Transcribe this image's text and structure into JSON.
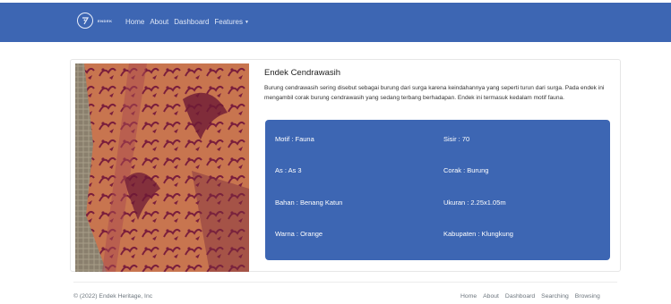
{
  "navbar": {
    "brand_text": "ENDEK",
    "links": [
      "Home",
      "About",
      "Dashboard"
    ],
    "dropdown_label": "Features",
    "bg_color": "#3d66b3"
  },
  "card": {
    "image_alt": "Endek Cendrawasih fabric",
    "title": "Endek Cendrawasih",
    "description": "Burung cendrawasih sering disebut sebagai burung dari surga karena keindahannya yang seperti turun dari surga. Pada endek ini mengambil corak burung cendrawasih yang sedang terbang berhadapan. Endek ini termasuk kedalam motif fauna.",
    "details": {
      "motif": "Motif : Fauna",
      "sisir": "Sisir : 70",
      "as": "As : As 3",
      "corak": "Corak : Burung",
      "bahan": "Bahan : Benang Katun",
      "ukuran": "Ukuran : 2.25x1.05m",
      "warna": "Warna : Orange",
      "kabupaten": "Kabupaten : Klungkung"
    }
  },
  "footer": {
    "copyright": "© (2022) Endek Heritage, Inc",
    "links": [
      "Home",
      "About",
      "Dashboard",
      "Searching",
      "Browsing"
    ]
  }
}
